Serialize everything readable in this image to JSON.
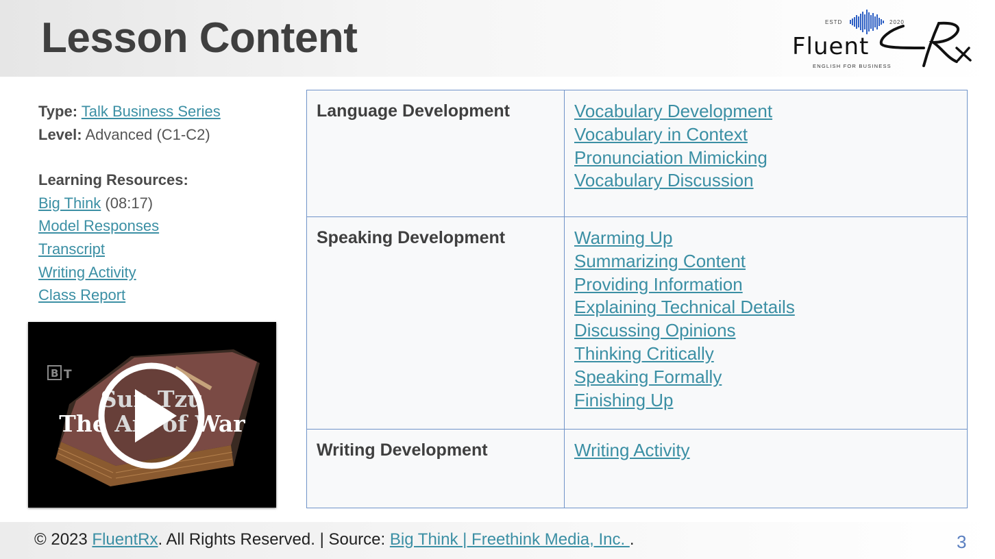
{
  "header": {
    "title": "Lesson Content"
  },
  "logo": {
    "word": "Fluent",
    "estd": "ESTD",
    "year": "2020",
    "tagline": "ENGLISH FOR BUSINESS"
  },
  "details": {
    "type_label": "Type:",
    "type_value": "Talk Business Series",
    "level_label": "Level:",
    "level_value": "Advanced (C1-C2)",
    "resources_label": "Learning Resources:",
    "resources": [
      {
        "label": "Big Think",
        "suffix": " (08:17)"
      },
      {
        "label": "Model Responses",
        "suffix": ""
      },
      {
        "label": "Transcript",
        "suffix": ""
      },
      {
        "label": "Writing Activity",
        "suffix": ""
      },
      {
        "label": "Class Report",
        "suffix": ""
      }
    ]
  },
  "video": {
    "title_line1": "Sun Tzu",
    "title_line2": "The Art of War",
    "channel_mark": "BT"
  },
  "table": {
    "rows": [
      {
        "category": "Language Development",
        "links": [
          "Vocabulary Development",
          "Vocabulary in Context",
          "Pronunciation Mimicking",
          "Vocabulary Discussion"
        ]
      },
      {
        "category": "Speaking Development",
        "links": [
          "Warming Up",
          "Summarizing Content",
          "Providing Information",
          "Explaining Technical Details",
          "Discussing Opinions",
          "Thinking Critically",
          "Speaking Formally",
          "Finishing Up"
        ]
      },
      {
        "category": "Writing Development",
        "links": [
          "Writing Activity"
        ]
      }
    ]
  },
  "footer": {
    "copyright": "© 2023 ",
    "brand": "FluentRx",
    "rights": ". All Rights Reserved. | Source: ",
    "source": "Big Think | Freethink Media, Inc. ",
    "end": ".",
    "page": "3"
  },
  "colors": {
    "link": "#3b8fa4",
    "border": "#6f93c8",
    "page_number": "#5a7fc0"
  }
}
